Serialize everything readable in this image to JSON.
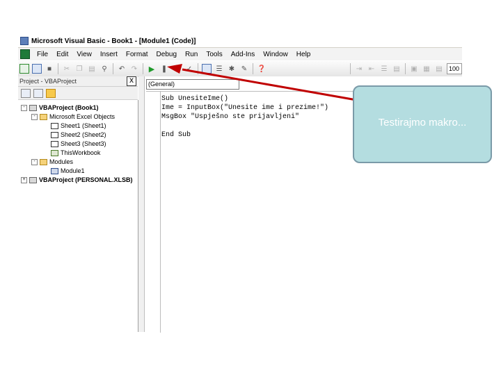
{
  "window": {
    "title": "Microsoft Visual Basic - Book1 - [Module1 (Code)]"
  },
  "menu": {
    "items": [
      "File",
      "Edit",
      "View",
      "Insert",
      "Format",
      "Debug",
      "Run",
      "Tools",
      "Add-Ins",
      "Window",
      "Help"
    ]
  },
  "toolbar": {
    "zoom": "100"
  },
  "project_pane": {
    "title": "Project - VBAProject",
    "close_label": "X",
    "tree": {
      "project1": "VBAProject (Book1)",
      "folder_objects": "Microsoft Excel Objects",
      "sheets": [
        "Sheet1 (Sheet1)",
        "Sheet2 (Sheet2)",
        "Sheet3 (Sheet3)"
      ],
      "workbook": "ThisWorkbook",
      "folder_modules": "Modules",
      "module": "Module1",
      "project2": "VBAProject (PERSONAL.XLSB)"
    }
  },
  "code_window": {
    "object_combo": "(General)",
    "lines": [
      "Sub UnesiteIme()",
      "Ime = InputBox(\"Unesite ime i prezime!\")",
      "MsgBox \"Uspješno ste prijavljeni\"",
      "",
      "End Sub"
    ]
  },
  "callout": {
    "text": "Testirajmo makro...",
    "fill": "#b4dde0",
    "border": "#7a9aa8"
  },
  "annotation": {
    "arrow_color": "#c00000"
  },
  "icons": [
    "excel-view-icon",
    "insert-object-icon",
    "save-icon",
    "cut-icon",
    "copy-icon",
    "paste-icon",
    "find-icon",
    "undo-icon",
    "redo-icon",
    "run-icon",
    "break-icon",
    "reset-icon",
    "design-mode-icon",
    "project-explorer-icon",
    "properties-icon",
    "object-browser-icon",
    "toolbox-icon",
    "help-icon"
  ]
}
